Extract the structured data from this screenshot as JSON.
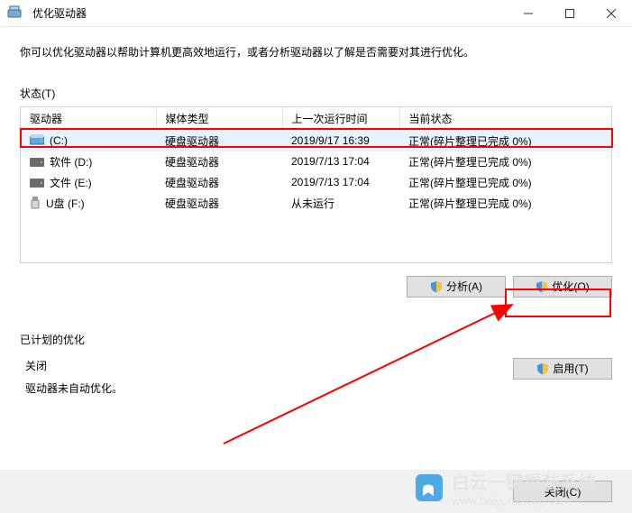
{
  "window": {
    "title": "优化驱动器"
  },
  "description": "你可以优化驱动器以帮助计算机更高效地运行，或者分析驱动器以了解是否需要对其进行优化。",
  "status_label": "状态(T)",
  "columns": {
    "drive": "驱动器",
    "media": "媒体类型",
    "last_run": "上一次运行时间",
    "status": "当前状态"
  },
  "drives": [
    {
      "name": "(C:)",
      "media": "硬盘驱动器",
      "last_run": "2019/9/17 16:39",
      "status": "正常(碎片整理已完成 0%)",
      "icon": "c"
    },
    {
      "name": "软件 (D:)",
      "media": "硬盘驱动器",
      "last_run": "2019/7/13 17:04",
      "status": "正常(碎片整理已完成 0%)",
      "icon": "hdd"
    },
    {
      "name": "文件 (E:)",
      "media": "硬盘驱动器",
      "last_run": "2019/7/13 17:04",
      "status": "正常(碎片整理已完成 0%)",
      "icon": "hdd"
    },
    {
      "name": "U盘 (F:)",
      "media": "硬盘驱动器",
      "last_run": "从未运行",
      "status": "正常(碎片整理已完成 0%)",
      "icon": "usb"
    }
  ],
  "buttons": {
    "analyze": "分析(A)",
    "optimize": "优化(O)",
    "enable": "启用(T)",
    "close": "关闭(C)"
  },
  "schedule": {
    "title": "已计划的优化",
    "status": "关闭",
    "desc": "驱动器未自动优化。"
  },
  "watermark": {
    "brand": "白云一键重装系统",
    "url": "www.baiyunxitong.com"
  }
}
